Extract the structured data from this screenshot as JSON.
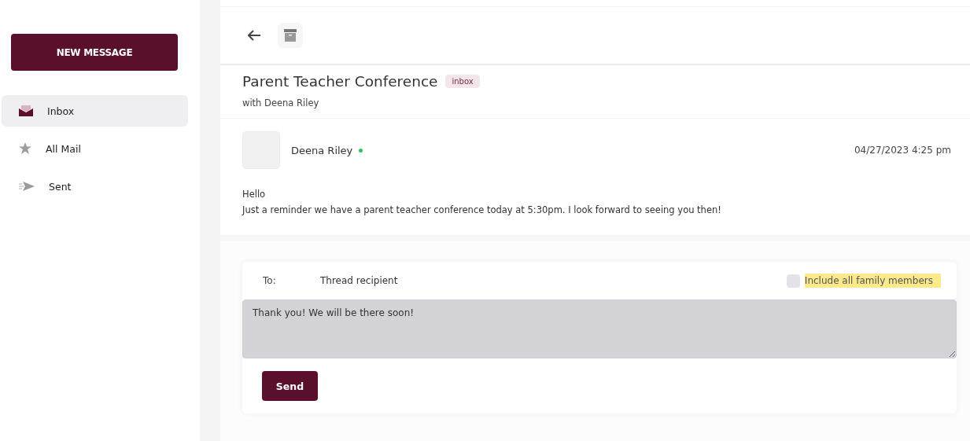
{
  "sidebar": {
    "new_button": "NEW MESSAGE",
    "items": [
      {
        "kind": "inbox",
        "label": "Inbox",
        "selected": true
      },
      {
        "kind": "all",
        "label": "All Mail",
        "selected": false
      },
      {
        "kind": "sent",
        "label": "Sent",
        "selected": false
      }
    ]
  },
  "thread": {
    "title": "Parent Teacher Conference",
    "tag": "inbox",
    "subtitle": "with Deena Riley",
    "message": {
      "sender": "Deena Riley",
      "online": true,
      "date": "04/27/2023 4:25 pm",
      "lines": [
        "Hello",
        "Just a reminder we have a parent teacher conference today at 5:30pm. I look forward to seeing you then!"
      ]
    }
  },
  "reply": {
    "to_label": "To:",
    "to_value": "Thread recipient",
    "include_family": {
      "label": "Include all family members",
      "checked": false,
      "highlighted": true
    },
    "body": "Thank you! We will be there soon!",
    "send": "Send"
  }
}
